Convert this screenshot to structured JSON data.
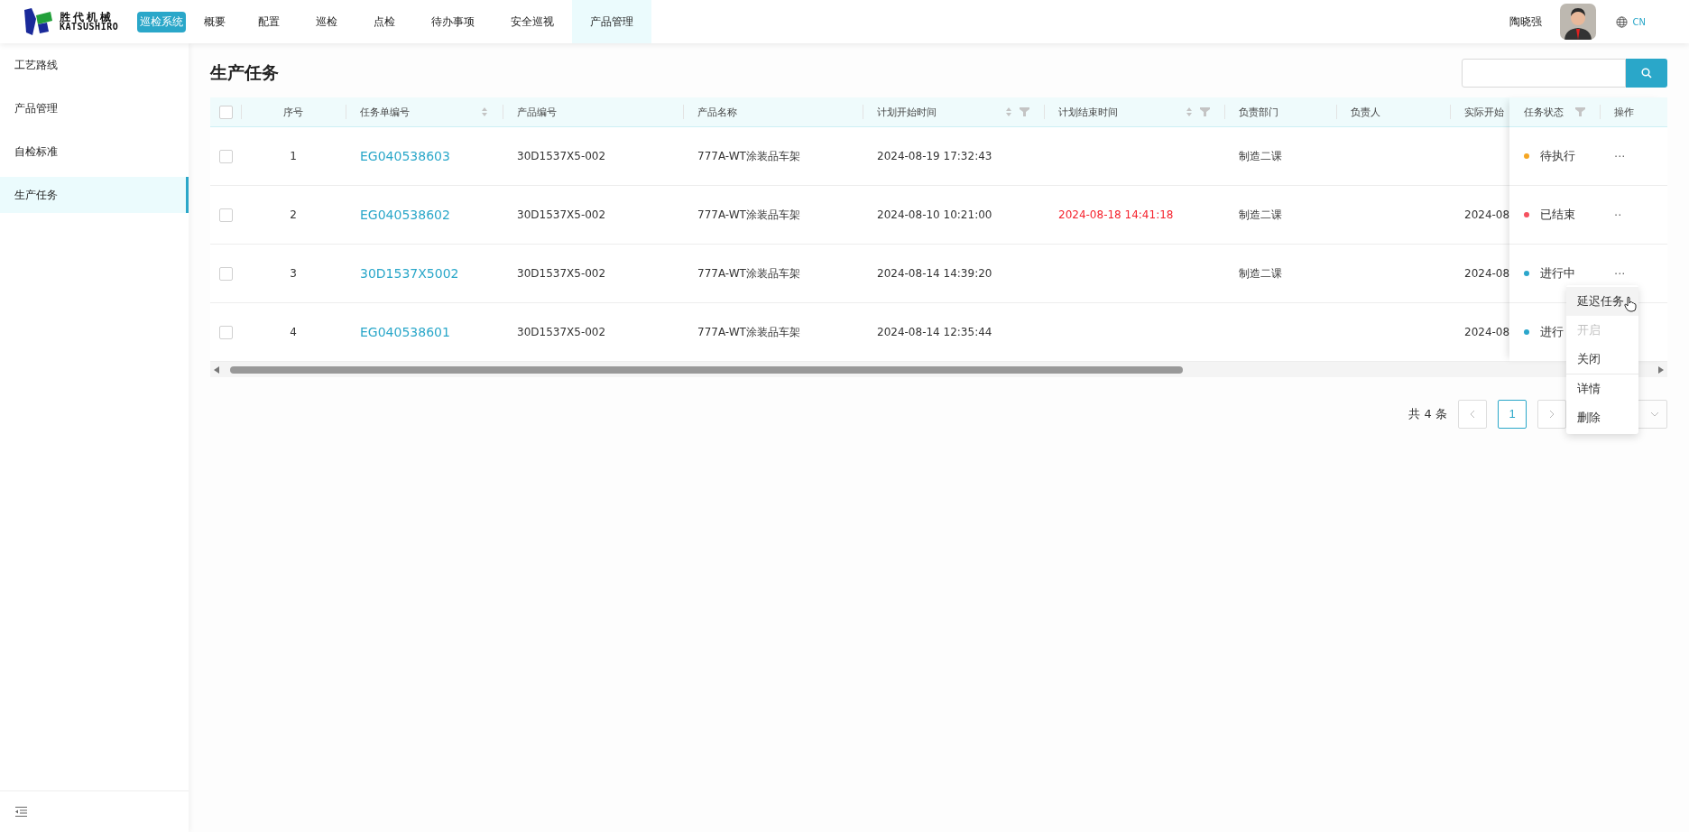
{
  "header": {
    "logo": {
      "name": "胜代机械",
      "latin": "KATSUSHIRO"
    },
    "system_badge": "巡检系统",
    "nav": [
      {
        "label": "概要",
        "selected": false
      },
      {
        "label": "配置",
        "selected": false
      },
      {
        "label": "巡检",
        "selected": false
      },
      {
        "label": "点检",
        "selected": false
      },
      {
        "label": "待办事项",
        "selected": false
      },
      {
        "label": "安全巡视",
        "selected": false
      },
      {
        "label": "产品管理",
        "selected": true
      }
    ],
    "user": {
      "name": "陶晓强"
    },
    "language": {
      "label": "CN",
      "selected": true
    }
  },
  "sidebar": {
    "items": [
      {
        "label": "工艺路线",
        "selected": false
      },
      {
        "label": "产品管理",
        "selected": false
      },
      {
        "label": "自检标准",
        "selected": false
      },
      {
        "label": "生产任务",
        "selected": true
      }
    ]
  },
  "page": {
    "title": "生产任务"
  },
  "table": {
    "select_all": {
      "checked": false
    },
    "columns": [
      {
        "label": "序号",
        "sortable": false,
        "filterable": false
      },
      {
        "label": "任务单编号",
        "sortable": true,
        "filterable": false
      },
      {
        "label": "产品编号",
        "sortable": false,
        "filterable": false
      },
      {
        "label": "产品名称",
        "sortable": false,
        "filterable": false
      },
      {
        "label": "计划开始时间",
        "sortable": true,
        "filterable": true
      },
      {
        "label": "计划结束时间",
        "sortable": true,
        "filterable": true
      },
      {
        "label": "负责部门",
        "sortable": false,
        "filterable": false
      },
      {
        "label": "负责人",
        "sortable": false,
        "filterable": false
      },
      {
        "label": "实际开始"
      }
    ],
    "fixed_columns": [
      {
        "label": "任务状态",
        "sortable": false,
        "filterable": true
      },
      {
        "label": "操作",
        "sortable": false,
        "filterable": false
      }
    ],
    "rows": [
      {
        "checked": false,
        "seq": "1",
        "task_no": "EG040538603",
        "product_no": "30D1537X5-002",
        "product_name": "777A-WT涂装品车架",
        "plan_start": "2024-08-19 17:32:43",
        "plan_end": "",
        "department": "制造二课",
        "owner": "",
        "actual_start": "",
        "status": "待执行",
        "color": "#f5a623",
        "actions": "···"
      },
      {
        "checked": false,
        "seq": "2",
        "task_no": "EG040538602",
        "product_no": "30D1537X5-002",
        "product_name": "777A-WT涂装品车架",
        "plan_start": "2024-08-10 10:21:00",
        "plan_end": "2024-08-18 14:41:18",
        "plan_end_overdue": true,
        "department": "制造二课",
        "owner": "",
        "actual_start": "2024-08",
        "status": "已结束",
        "color": "#f5515f",
        "actions": "··"
      },
      {
        "checked": false,
        "seq": "3",
        "task_no": "30D1537X5002",
        "product_no": "30D1537X5-002",
        "product_name": "777A-WT涂装品车架",
        "plan_start": "2024-08-14 14:39:20",
        "plan_end": "",
        "department": "制造二课",
        "owner": "",
        "actual_start": "2024-08",
        "status": "进行中",
        "color": "#2ba6cb",
        "actions": "···"
      },
      {
        "checked": false,
        "seq": "4",
        "task_no": "EG040538601",
        "product_no": "30D1537X5-002",
        "product_name": "777A-WT涂装品车架",
        "plan_start": "2024-08-14 12:35:44",
        "plan_end": "",
        "department": "",
        "owner": "",
        "actual_start": "2024-08",
        "status": "进行",
        "color": "#2ba6cb",
        "actions": ""
      }
    ]
  },
  "pagination": {
    "total": "共 4 条",
    "pages": [
      {
        "label": "1",
        "selected": true
      }
    ]
  },
  "action_menu": {
    "items": [
      {
        "label": "延迟任务",
        "hovered": true,
        "disabled": false
      },
      {
        "label": "开启",
        "hovered": false,
        "disabled": true
      },
      {
        "label": "关闭",
        "hovered": false,
        "disabled": false,
        "divider_after": true
      },
      {
        "label": "详情",
        "hovered": false,
        "disabled": false
      },
      {
        "label": "删除",
        "hovered": false,
        "disabled": false
      }
    ]
  }
}
